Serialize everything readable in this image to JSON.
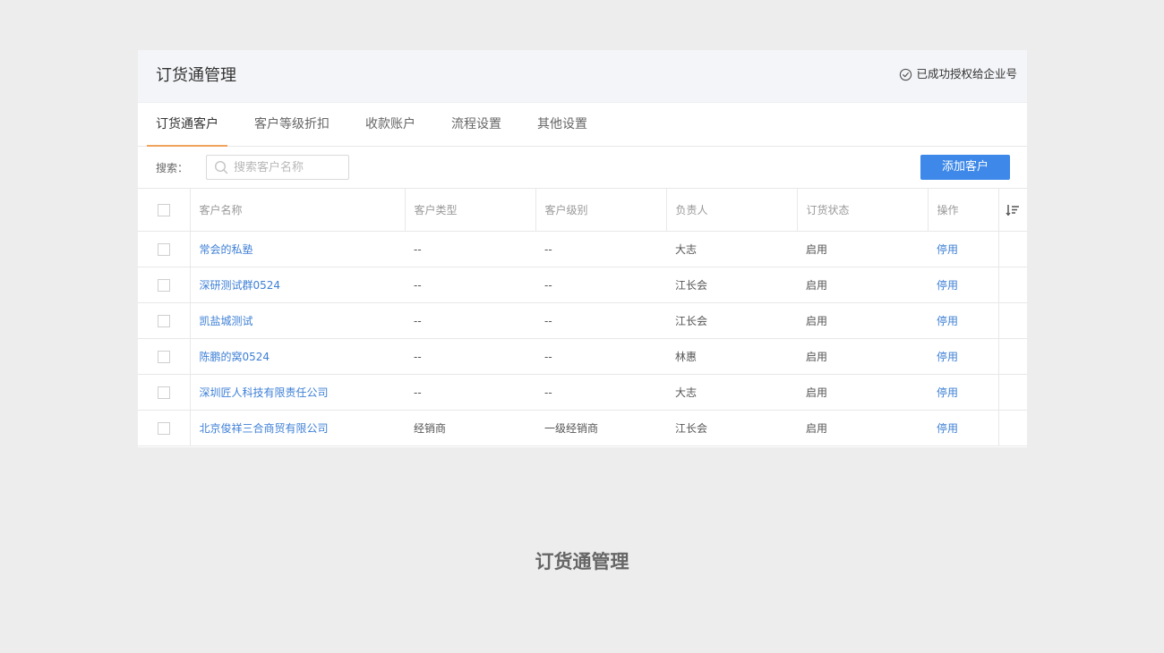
{
  "header": {
    "title": "订货通管理",
    "auth_status": "已成功授权给企业号"
  },
  "tabs": [
    {
      "label": "订货通客户",
      "active": true
    },
    {
      "label": "客户等级折扣",
      "active": false
    },
    {
      "label": "收款账户",
      "active": false
    },
    {
      "label": "流程设置",
      "active": false
    },
    {
      "label": "其他设置",
      "active": false
    }
  ],
  "toolbar": {
    "search_label": "搜索：",
    "search_placeholder": "搜索客户名称",
    "add_button": "添加客户"
  },
  "table": {
    "columns": [
      "客户名称",
      "客户类型",
      "客户级别",
      "负责人",
      "订货状态",
      "操作"
    ],
    "rows": [
      {
        "name": "常会的私塾",
        "type": "--",
        "level": "--",
        "owner": "大志",
        "status": "启用",
        "action": "停用"
      },
      {
        "name": "深研测试群0524",
        "type": "--",
        "level": "--",
        "owner": "江长会",
        "status": "启用",
        "action": "停用"
      },
      {
        "name": "凯盐城测试",
        "type": "--",
        "level": "--",
        "owner": "江长会",
        "status": "启用",
        "action": "停用"
      },
      {
        "name": "陈鹏的窝0524",
        "type": "--",
        "level": "--",
        "owner": "林惠",
        "status": "启用",
        "action": "停用"
      },
      {
        "name": "深圳匠人科技有限责任公司",
        "type": "--",
        "level": "--",
        "owner": "大志",
        "status": "启用",
        "action": "停用"
      },
      {
        "name": "北京俊祥三合商贸有限公司",
        "type": "经销商",
        "level": "一级经销商",
        "owner": "江长会",
        "status": "启用",
        "action": "停用"
      }
    ]
  },
  "footer": {
    "title": "订货通管理"
  },
  "colors": {
    "accent": "#3d88e8",
    "link": "#3d7fd6",
    "active_tab_underline": "#f0a35b",
    "page_background": "#ededed"
  }
}
